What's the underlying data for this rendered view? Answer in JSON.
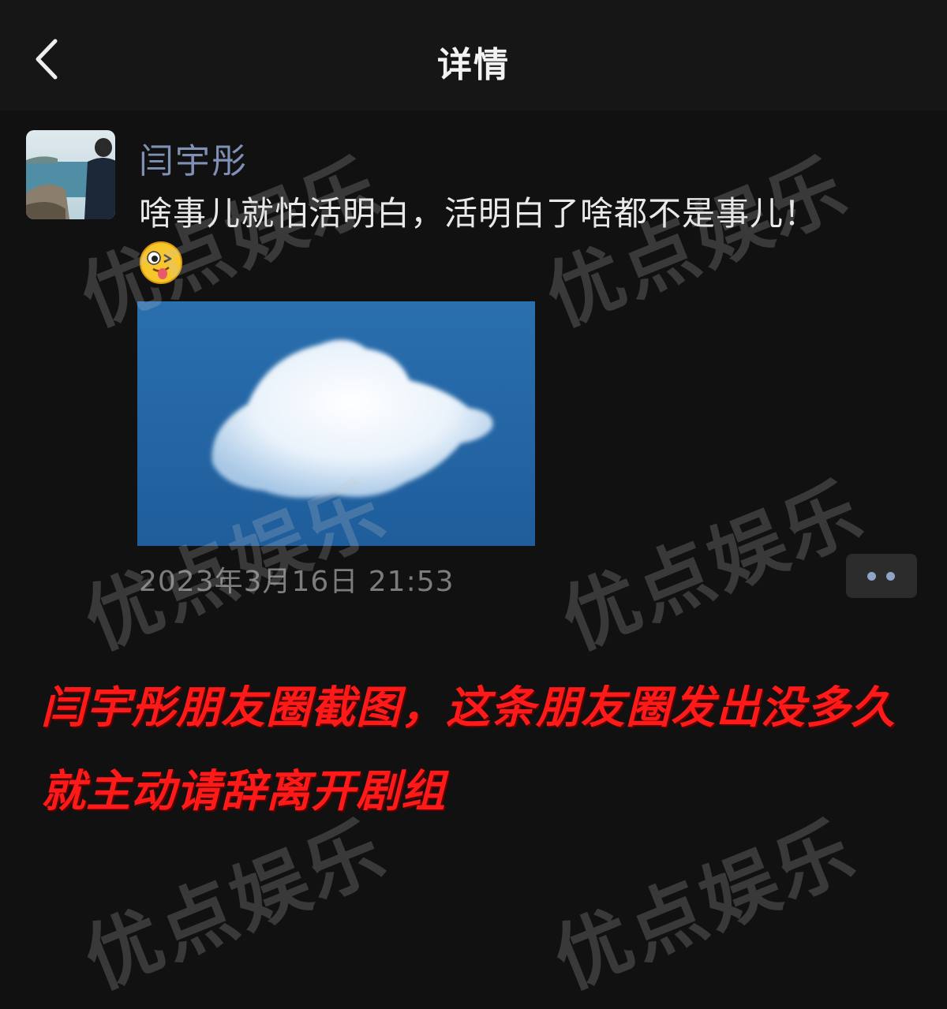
{
  "header": {
    "title": "详情",
    "back_icon": "chevron-left-icon"
  },
  "post": {
    "author": "闫宇彤",
    "text": "啥事儿就怕活明白，活明白了啥都不是事儿！",
    "emoji_icon": "winking-tongue-emoji-icon",
    "timestamp": "2023年3月16日 21:53",
    "more_icon": "more-dots-icon"
  },
  "caption": {
    "line1": "闫宇彤朋友圈截图，这条朋友圈发出没多久",
    "line2": "就主动请辞离开剧组"
  },
  "watermark": {
    "text": "优点娱乐"
  },
  "colors": {
    "background": "#111111",
    "author_name": "#7f91b5",
    "caption_red": "#ff1a1a",
    "timestamp_gray": "#7c7c7c"
  }
}
